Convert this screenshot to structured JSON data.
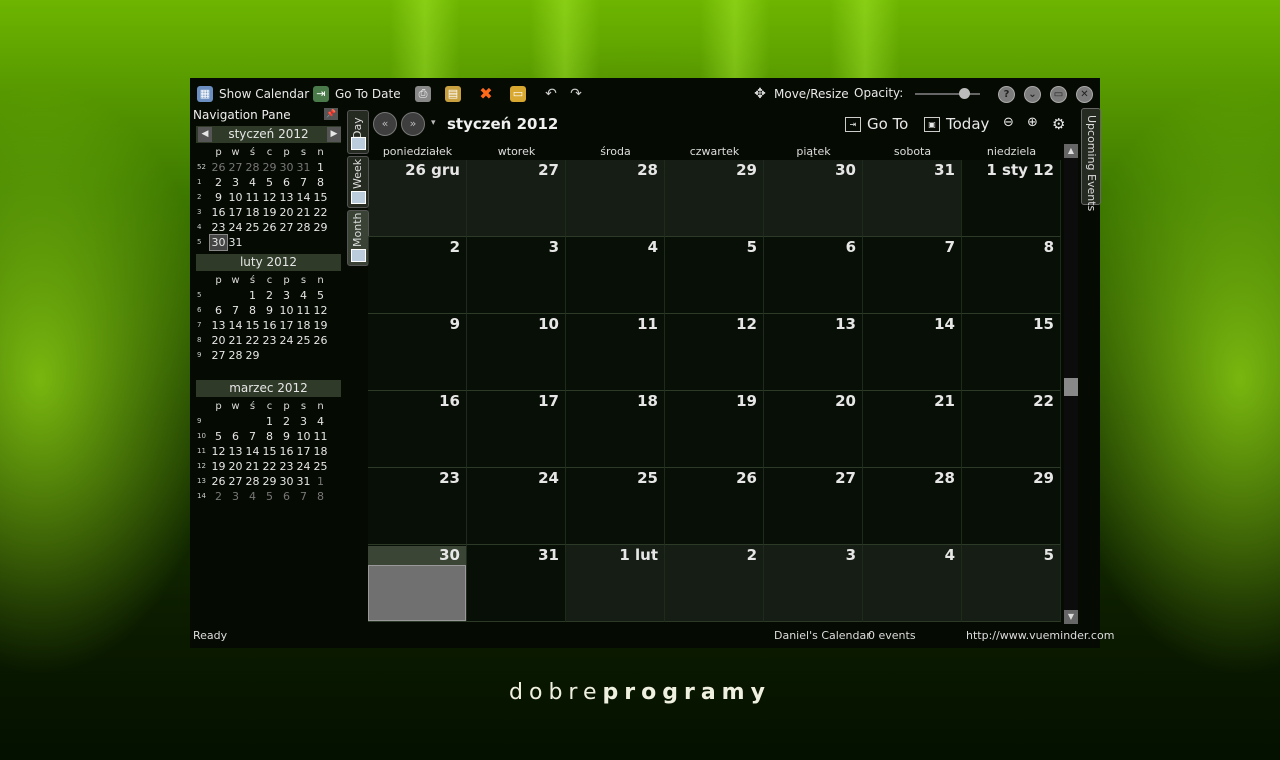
{
  "toolbar": {
    "show_calendar": "Show Calendar",
    "go_to_date": "Go To Date",
    "move_resize": "Move/Resize",
    "opacity_label": "Opacity:",
    "opacity_value": 0.75
  },
  "nav_pane": {
    "title": "Navigation Pane",
    "weekday_headers": [
      "p",
      "w",
      "ś",
      "c",
      "p",
      "s",
      "n"
    ],
    "months": [
      {
        "title": "styczeń 2012",
        "weeks": [
          {
            "wk": "52",
            "days": [
              "26",
              "27",
              "28",
              "29",
              "30",
              "31",
              "1"
            ],
            "dim": [
              0,
              1,
              2,
              3,
              4,
              5
            ]
          },
          {
            "wk": "1",
            "days": [
              "2",
              "3",
              "4",
              "5",
              "6",
              "7",
              "8"
            ],
            "dim": []
          },
          {
            "wk": "2",
            "days": [
              "9",
              "10",
              "11",
              "12",
              "13",
              "14",
              "15"
            ],
            "dim": []
          },
          {
            "wk": "3",
            "days": [
              "16",
              "17",
              "18",
              "19",
              "20",
              "21",
              "22"
            ],
            "dim": []
          },
          {
            "wk": "4",
            "days": [
              "23",
              "24",
              "25",
              "26",
              "27",
              "28",
              "29"
            ],
            "dim": []
          },
          {
            "wk": "5",
            "days": [
              "30",
              "31",
              "",
              "",
              "",
              "",
              ""
            ],
            "dim": [],
            "sel": 0
          }
        ]
      },
      {
        "title": "luty 2012",
        "weeks": [
          {
            "wk": "5",
            "days": [
              "",
              "",
              "1",
              "2",
              "3",
              "4",
              "5"
            ],
            "dim": []
          },
          {
            "wk": "6",
            "days": [
              "6",
              "7",
              "8",
              "9",
              "10",
              "11",
              "12"
            ],
            "dim": []
          },
          {
            "wk": "7",
            "days": [
              "13",
              "14",
              "15",
              "16",
              "17",
              "18",
              "19"
            ],
            "dim": []
          },
          {
            "wk": "8",
            "days": [
              "20",
              "21",
              "22",
              "23",
              "24",
              "25",
              "26"
            ],
            "dim": []
          },
          {
            "wk": "9",
            "days": [
              "27",
              "28",
              "29",
              "",
              "",
              "",
              ""
            ],
            "dim": []
          }
        ]
      },
      {
        "title": "marzec 2012",
        "weeks": [
          {
            "wk": "9",
            "days": [
              "",
              "",
              "",
              "1",
              "2",
              "3",
              "4"
            ],
            "dim": []
          },
          {
            "wk": "10",
            "days": [
              "5",
              "6",
              "7",
              "8",
              "9",
              "10",
              "11"
            ],
            "dim": []
          },
          {
            "wk": "11",
            "days": [
              "12",
              "13",
              "14",
              "15",
              "16",
              "17",
              "18"
            ],
            "dim": []
          },
          {
            "wk": "12",
            "days": [
              "19",
              "20",
              "21",
              "22",
              "23",
              "24",
              "25"
            ],
            "dim": []
          },
          {
            "wk": "13",
            "days": [
              "26",
              "27",
              "28",
              "29",
              "30",
              "31",
              "1"
            ],
            "dim": [
              6
            ]
          },
          {
            "wk": "14",
            "days": [
              "2",
              "3",
              "4",
              "5",
              "6",
              "7",
              "8"
            ],
            "dim": [
              0,
              1,
              2,
              3,
              4,
              5,
              6
            ]
          }
        ]
      }
    ]
  },
  "view_tabs": {
    "day": "Day",
    "week": "Week",
    "month": "Month"
  },
  "calendar": {
    "title": "styczeń 2012",
    "go_to": "Go To",
    "today": "Today",
    "day_names": [
      "poniedziałek",
      "wtorek",
      "środa",
      "czwartek",
      "piątek",
      "sobota",
      "niedziela"
    ],
    "cells": [
      {
        "n": "26 gru",
        "o": true
      },
      {
        "n": "27",
        "o": true
      },
      {
        "n": "28",
        "o": true
      },
      {
        "n": "29",
        "o": true
      },
      {
        "n": "30",
        "o": true
      },
      {
        "n": "31",
        "o": true
      },
      {
        "n": "1 sty 12",
        "o": false
      },
      {
        "n": "2",
        "o": false
      },
      {
        "n": "3",
        "o": false
      },
      {
        "n": "4",
        "o": false
      },
      {
        "n": "5",
        "o": false
      },
      {
        "n": "6",
        "o": false
      },
      {
        "n": "7",
        "o": false
      },
      {
        "n": "8",
        "o": false
      },
      {
        "n": "9",
        "o": false
      },
      {
        "n": "10",
        "o": false
      },
      {
        "n": "11",
        "o": false
      },
      {
        "n": "12",
        "o": false
      },
      {
        "n": "13",
        "o": false
      },
      {
        "n": "14",
        "o": false
      },
      {
        "n": "15",
        "o": false
      },
      {
        "n": "16",
        "o": false
      },
      {
        "n": "17",
        "o": false
      },
      {
        "n": "18",
        "o": false
      },
      {
        "n": "19",
        "o": false
      },
      {
        "n": "20",
        "o": false
      },
      {
        "n": "21",
        "o": false
      },
      {
        "n": "22",
        "o": false
      },
      {
        "n": "23",
        "o": false
      },
      {
        "n": "24",
        "o": false
      },
      {
        "n": "25",
        "o": false
      },
      {
        "n": "26",
        "o": false
      },
      {
        "n": "27",
        "o": false
      },
      {
        "n": "28",
        "o": false
      },
      {
        "n": "29",
        "o": false
      },
      {
        "n": "30",
        "o": false,
        "t": true
      },
      {
        "n": "31",
        "o": false
      },
      {
        "n": "1 lut",
        "o": true
      },
      {
        "n": "2",
        "o": true
      },
      {
        "n": "3",
        "o": true
      },
      {
        "n": "4",
        "o": true
      },
      {
        "n": "5",
        "o": true
      }
    ]
  },
  "upcoming_events": "Upcoming Events",
  "status": {
    "ready": "Ready",
    "calendar_name": "Daniel's Calendar",
    "events": "0 events",
    "url": "http://www.vueminder.com"
  },
  "brand": {
    "light": "dobre",
    "bold": "programy"
  }
}
